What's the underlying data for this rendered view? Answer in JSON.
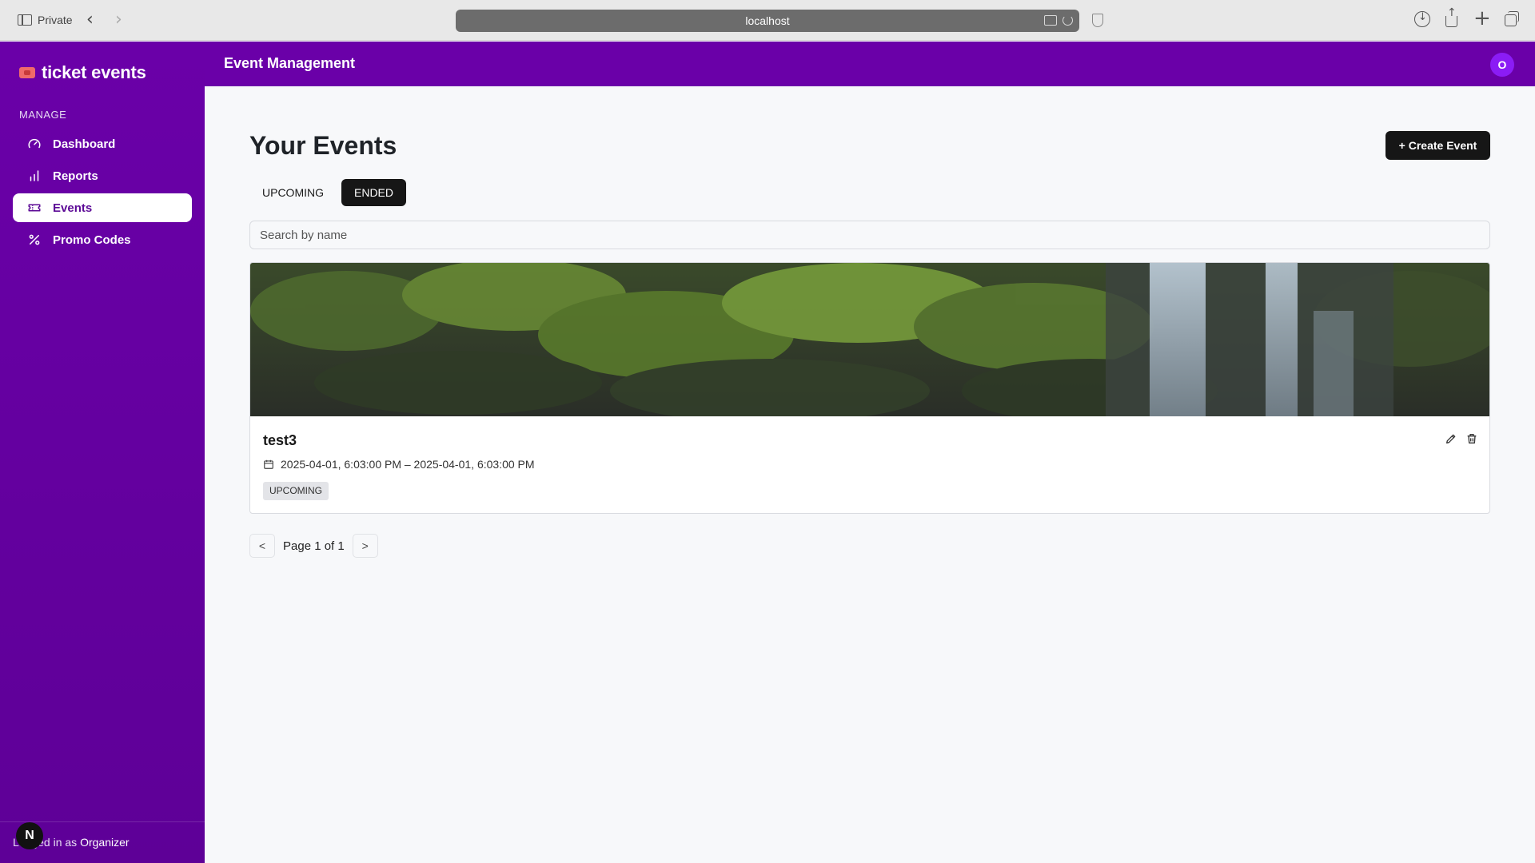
{
  "browser": {
    "private_label": "Private",
    "url": "localhost"
  },
  "sidebar": {
    "logo_text": "ticket events",
    "section_label": "MANAGE",
    "items": [
      {
        "label": "Dashboard",
        "icon": "gauge-icon"
      },
      {
        "label": "Reports",
        "icon": "bar-chart-icon"
      },
      {
        "label": "Events",
        "icon": "ticket-icon",
        "active": true
      },
      {
        "label": "Promo Codes",
        "icon": "percent-icon"
      }
    ],
    "footer_prefix": "Logged in as ",
    "footer_role": "Organizer",
    "n_badge": "N"
  },
  "header": {
    "title": "Event Management",
    "avatar_initial": "O"
  },
  "main": {
    "page_title": "Your Events",
    "create_button": "+ Create Event",
    "tabs": [
      {
        "label": "UPCOMING",
        "active": false
      },
      {
        "label": "ENDED",
        "active": true
      }
    ],
    "search_placeholder": "Search by name",
    "events": [
      {
        "name": "test3",
        "date_range": "2025-04-01, 6:03:00 PM – 2025-04-01, 6:03:00 PM",
        "status": "UPCOMING"
      }
    ],
    "pagination": {
      "prev": "<",
      "text": "Page 1 of 1",
      "next": ">"
    }
  },
  "colors": {
    "brand_purple": "#6a00a8",
    "avatar_purple": "#8b1cf5",
    "primary_dark": "#161616"
  }
}
